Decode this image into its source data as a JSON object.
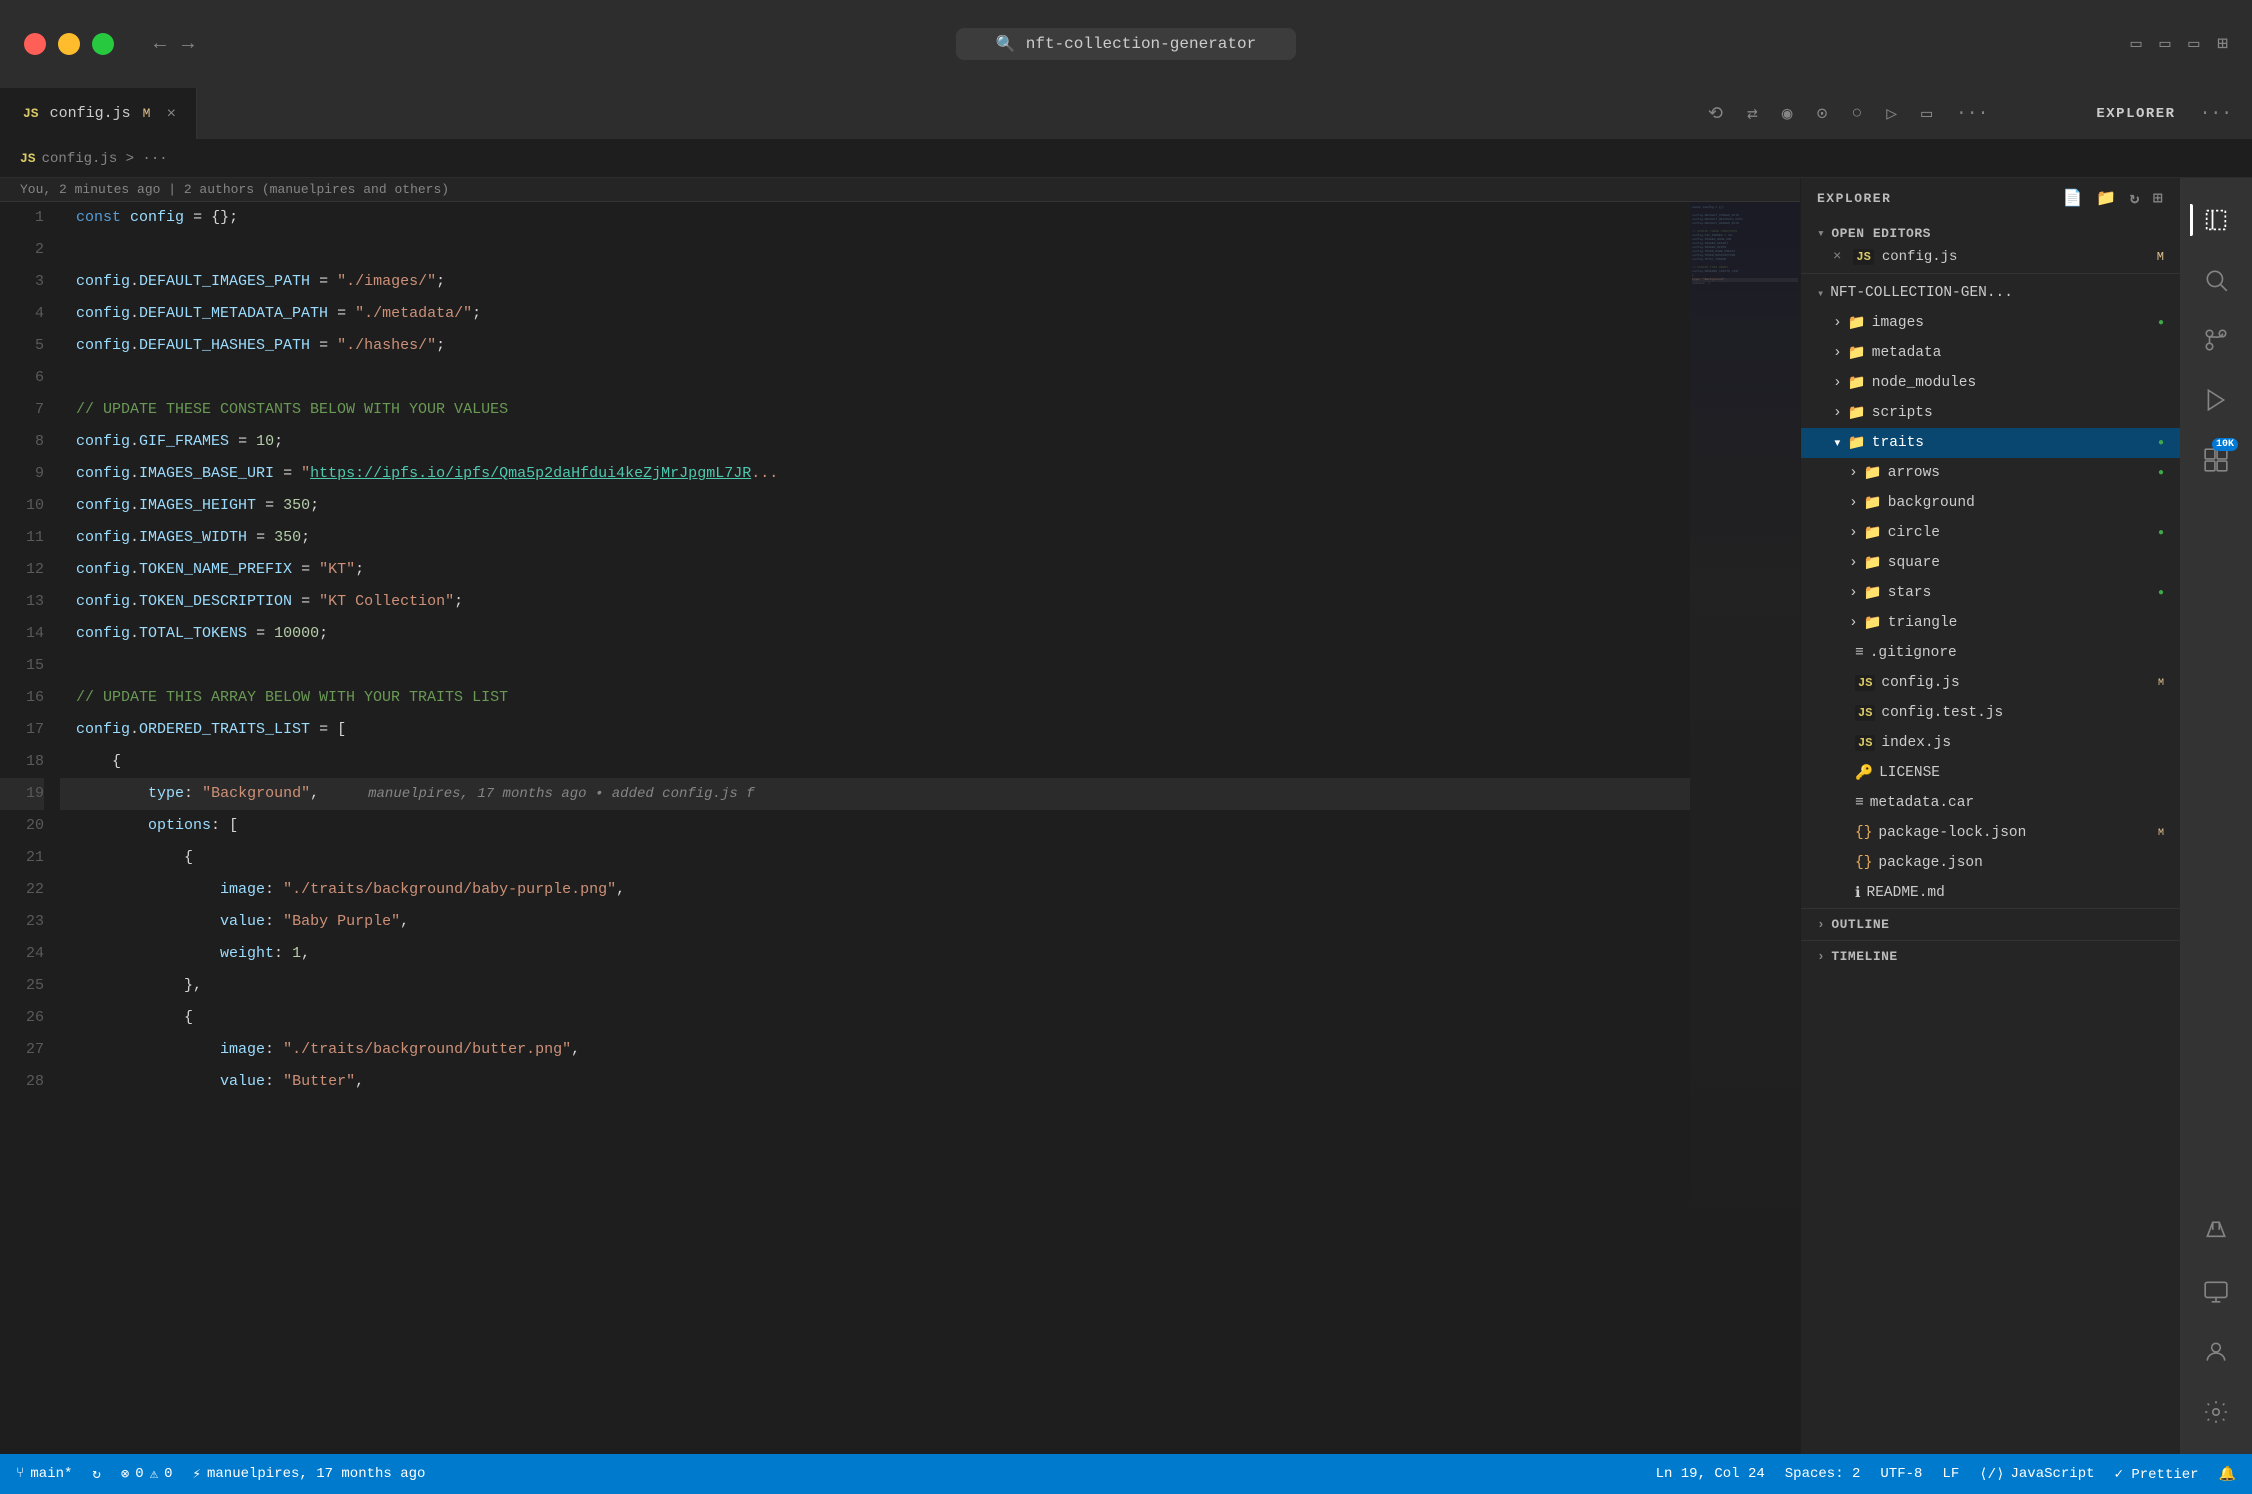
{
  "titlebar": {
    "search_text": "nft-collection-generator",
    "nav_back": "←",
    "nav_forward": "→"
  },
  "tab": {
    "icon": "JS",
    "name": "config.js",
    "modified": "M",
    "close": "×"
  },
  "tab_actions": [
    "⟲",
    "⇄",
    "◉",
    "⊙",
    "○",
    "→|",
    "▭",
    "···"
  ],
  "breadcrumb": {
    "icon": "JS",
    "path": "config.js > ···"
  },
  "blame": {
    "text": "You, 2 minutes ago | 2 authors (manuelpires and others)"
  },
  "code_lines": [
    {
      "num": 1,
      "content": "const_config",
      "raw": "const config = {};"
    },
    {
      "num": 2,
      "content": "",
      "raw": ""
    },
    {
      "num": 3,
      "content": "",
      "raw": "config.DEFAULT_IMAGES_PATH = \"./images/\";"
    },
    {
      "num": 4,
      "content": "",
      "raw": "config.DEFAULT_METADATA_PATH = \"./metadata/\";"
    },
    {
      "num": 5,
      "content": "",
      "raw": "config.DEFAULT_HASHES_PATH = \"./hashes/\";"
    },
    {
      "num": 6,
      "content": "",
      "raw": ""
    },
    {
      "num": 7,
      "content": "",
      "raw": "// UPDATE THESE CONSTANTS BELOW WITH YOUR VALUES"
    },
    {
      "num": 8,
      "content": "",
      "raw": "config.GIF_FRAMES = 10;"
    },
    {
      "num": 9,
      "content": "",
      "raw": "config.IMAGES_BASE_URI = \"https://ipfs.io/ipfs/Qma5p2daHfdui4keZjMrJpgmL7JR..."
    },
    {
      "num": 10,
      "content": "",
      "raw": "config.IMAGES_HEIGHT = 350;"
    },
    {
      "num": 11,
      "content": "",
      "raw": "config.IMAGES_WIDTH = 350;"
    },
    {
      "num": 12,
      "content": "",
      "raw": "config.TOKEN_NAME_PREFIX = \"KT\";"
    },
    {
      "num": 13,
      "content": "",
      "raw": "config.TOKEN_DESCRIPTION = \"KT Collection\";"
    },
    {
      "num": 14,
      "content": "",
      "raw": "config.TOTAL_TOKENS = 10000;"
    },
    {
      "num": 15,
      "content": "",
      "raw": ""
    },
    {
      "num": 16,
      "content": "",
      "raw": "// UPDATE THIS ARRAY BELOW WITH YOUR TRAITS LIST"
    },
    {
      "num": 17,
      "content": "",
      "raw": "config.ORDERED_TRAITS_LIST = ["
    },
    {
      "num": 18,
      "content": "",
      "raw": "    {"
    },
    {
      "num": 19,
      "content": "",
      "raw": "        type: \"Background\",",
      "blame": "manuelpires, 17 months ago • added config.js f"
    },
    {
      "num": 20,
      "content": "",
      "raw": "        options: ["
    },
    {
      "num": 21,
      "content": "",
      "raw": "            {"
    },
    {
      "num": 22,
      "content": "",
      "raw": "                image: \"./traits/background/baby-purple.png\","
    },
    {
      "num": 23,
      "content": "",
      "raw": "                value: \"Baby Purple\","
    },
    {
      "num": 24,
      "content": "",
      "raw": "                weight: 1,"
    },
    {
      "num": 25,
      "content": "",
      "raw": "            },"
    },
    {
      "num": 26,
      "content": "",
      "raw": "            {"
    },
    {
      "num": 27,
      "content": "",
      "raw": "                image: \"./traits/background/butter.png\","
    },
    {
      "num": 28,
      "content": "",
      "raw": "                value: \"Butter\","
    }
  ],
  "sidebar": {
    "header": "EXPLORER",
    "open_editors_section": "OPEN EDITORS",
    "open_editors_items": [
      {
        "icon": "JS",
        "name": "config.js",
        "modified": "M"
      }
    ],
    "root_folder": "NFT-COLLECTION-GEN...",
    "tree": [
      {
        "type": "folder",
        "name": "images",
        "indent": 1,
        "expanded": false,
        "dot": true
      },
      {
        "type": "folder",
        "name": "metadata",
        "indent": 1,
        "expanded": false
      },
      {
        "type": "folder",
        "name": "node_modules",
        "indent": 1,
        "expanded": false
      },
      {
        "type": "folder",
        "name": "scripts",
        "indent": 1,
        "expanded": false
      },
      {
        "type": "folder",
        "name": "traits",
        "indent": 1,
        "expanded": true,
        "active": true,
        "dot": true
      },
      {
        "type": "folder",
        "name": "arrows",
        "indent": 2,
        "expanded": false,
        "dot": true
      },
      {
        "type": "folder",
        "name": "background",
        "indent": 2,
        "expanded": false
      },
      {
        "type": "folder",
        "name": "circle",
        "indent": 2,
        "expanded": false,
        "dot": true
      },
      {
        "type": "folder",
        "name": "square",
        "indent": 2,
        "expanded": false
      },
      {
        "type": "folder",
        "name": "stars",
        "indent": 2,
        "expanded": false,
        "dot": true
      },
      {
        "type": "folder",
        "name": "triangle",
        "indent": 2,
        "expanded": false
      },
      {
        "type": "file",
        "name": ".gitignore",
        "indent": 1,
        "icon": "≡"
      },
      {
        "type": "file",
        "name": "config.js",
        "indent": 1,
        "icon": "JS",
        "modified": "M"
      },
      {
        "type": "file",
        "name": "config.test.js",
        "indent": 1,
        "icon": "JS"
      },
      {
        "type": "file",
        "name": "index.js",
        "indent": 1,
        "icon": "JS"
      },
      {
        "type": "file",
        "name": "LICENSE",
        "indent": 1,
        "icon": "🔑"
      },
      {
        "type": "file",
        "name": "metadata.car",
        "indent": 1,
        "icon": "≡"
      },
      {
        "type": "file",
        "name": "package-lock.json",
        "indent": 1,
        "icon": "{}",
        "modified": "M"
      },
      {
        "type": "file",
        "name": "package.json",
        "indent": 1,
        "icon": "{}"
      },
      {
        "type": "file",
        "name": "README.md",
        "indent": 1,
        "icon": "ℹ"
      }
    ],
    "outline": "OUTLINE",
    "timeline": "TIMELINE"
  },
  "activity_bar": {
    "icons": [
      {
        "icon": "⎘",
        "name": "explorer",
        "active": true
      },
      {
        "icon": "🔍",
        "name": "search"
      },
      {
        "icon": "⑂",
        "name": "source-control"
      },
      {
        "icon": "▷",
        "name": "run"
      },
      {
        "icon": "⊞",
        "name": "extensions",
        "badge": "10K"
      },
      {
        "icon": "🧪",
        "name": "testing"
      },
      {
        "icon": "≡",
        "name": "remote-explorer"
      },
      {
        "icon": "📁",
        "name": "file-sync"
      }
    ],
    "bottom_icons": [
      {
        "icon": "↻",
        "name": "refresh"
      },
      {
        "icon": "⚙",
        "name": "settings"
      },
      {
        "icon": "👤",
        "name": "account"
      }
    ]
  },
  "status_bar": {
    "branch": "main*",
    "sync": "↻",
    "errors": "⊗ 0",
    "warnings": "⚠ 0",
    "user": "manuelpires, 17 months ago",
    "position": "Ln 19, Col 24",
    "spaces": "Spaces: 2",
    "encoding": "UTF-8",
    "eol": "LF",
    "language": "JavaScript",
    "formatter": "✓ Prettier",
    "notifications": "🔔"
  }
}
